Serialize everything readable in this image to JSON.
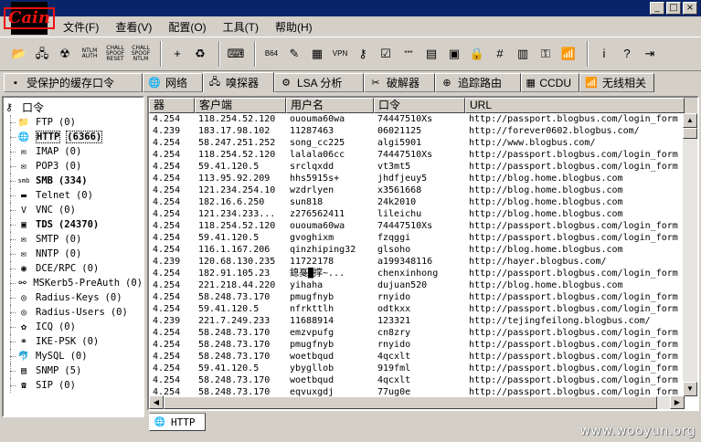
{
  "app": {
    "logo_text": "Cain"
  },
  "window_buttons": [
    "_",
    "□",
    "×"
  ],
  "menu": [
    "文件(F)",
    "查看(V)",
    "配置(O)",
    "工具(T)",
    "帮助(H)"
  ],
  "toolbar": {
    "buttons": [
      {
        "icon": "folder-open-icon",
        "glyph": "📂"
      },
      {
        "icon": "network-card-icon",
        "glyph": "🖧"
      },
      {
        "icon": "radiation-icon",
        "glyph": "☢"
      }
    ],
    "text_buttons": [
      {
        "line1": "NTLM",
        "line2": "AUTH",
        "line3": ""
      },
      {
        "line1": "CHALL",
        "line2": "SPOOF",
        "line3": "RESET"
      },
      {
        "line1": "CHALL",
        "line2": "SPOOF",
        "line3": "NTLM"
      }
    ],
    "buttons2": [
      {
        "icon": "add-icon",
        "glyph": "+"
      },
      {
        "icon": "recycle-bin-icon",
        "glyph": "♻"
      },
      {
        "icon": "decode-icon",
        "glyph": "⌨"
      },
      {
        "icon": "base64-icon",
        "glyph": "B64"
      },
      {
        "icon": "notepad-icon",
        "glyph": "✎"
      },
      {
        "icon": "routing-icon",
        "glyph": "▦"
      },
      {
        "icon": "vpn-icon",
        "glyph": "VPN"
      },
      {
        "icon": "key-icon",
        "glyph": "⚷"
      },
      {
        "icon": "certificate-icon",
        "glyph": "☑"
      },
      {
        "icon": "password-icon",
        "glyph": "***"
      },
      {
        "icon": "terminal-icon",
        "glyph": "▤"
      },
      {
        "icon": "monitor-icon",
        "glyph": "▣"
      },
      {
        "icon": "lock-icon",
        "glyph": "🔒"
      },
      {
        "icon": "hash-icon",
        "glyph": "#"
      },
      {
        "icon": "books-icon",
        "glyph": "▥"
      },
      {
        "icon": "keyring-icon",
        "glyph": "⚿"
      },
      {
        "icon": "wireless-icon",
        "glyph": "📶"
      },
      {
        "icon": "info-icon",
        "glyph": "i"
      },
      {
        "icon": "help-icon",
        "glyph": "?"
      },
      {
        "icon": "exit-icon",
        "glyph": "⇥"
      }
    ]
  },
  "tabs": [
    {
      "label": "受保护的缓存口令",
      "icon": "protected-storage-icon",
      "glyph": "▪",
      "active": false
    },
    {
      "label": "网络",
      "icon": "network-globe-icon",
      "glyph": "🌐",
      "active": false
    },
    {
      "label": "嗅探器",
      "icon": "sniffer-icon",
      "glyph": "🖧",
      "active": true
    },
    {
      "label": "LSA 分析",
      "icon": "lsa-icon",
      "glyph": "⚙",
      "active": false
    },
    {
      "label": "破解器",
      "icon": "cracker-icon",
      "glyph": "✂",
      "active": false
    },
    {
      "label": "追踪路由",
      "icon": "traceroute-icon",
      "glyph": "⊕",
      "active": false
    },
    {
      "label": "CCDU",
      "icon": "ccdu-icon",
      "glyph": "▦",
      "active": false
    },
    {
      "label": "无线相关",
      "icon": "wireless-tab-icon",
      "glyph": "📶",
      "active": false
    }
  ],
  "tree": {
    "root": "口令",
    "items": [
      {
        "label": "FTP",
        "count": "(0)",
        "icon": "ftp-icon",
        "glyph": "📁",
        "bold": false
      },
      {
        "label": "HTTP",
        "count": "(6366)",
        "icon": "http-icon",
        "glyph": "🌐",
        "bold": true,
        "selected": true
      },
      {
        "label": "IMAP",
        "count": "(0)",
        "icon": "imap-icon",
        "glyph": "✉",
        "bold": false
      },
      {
        "label": "POP3",
        "count": "(0)",
        "icon": "pop3-icon",
        "glyph": "✉",
        "bold": false
      },
      {
        "label": "SMB",
        "count": "(334)",
        "icon": "smb-icon",
        "glyph": "smb",
        "bold": true
      },
      {
        "label": "Telnet",
        "count": "(0)",
        "icon": "telnet-icon",
        "glyph": "▬",
        "bold": false
      },
      {
        "label": "VNC",
        "count": "(0)",
        "icon": "vnc-icon",
        "glyph": "V",
        "bold": false
      },
      {
        "label": "TDS",
        "count": "(24370)",
        "icon": "tds-icon",
        "glyph": "▣",
        "bold": true
      },
      {
        "label": "SMTP",
        "count": "(0)",
        "icon": "smtp-icon",
        "glyph": "✉",
        "bold": false
      },
      {
        "label": "NNTP",
        "count": "(0)",
        "icon": "nntp-icon",
        "glyph": "✉",
        "bold": false
      },
      {
        "label": "DCE/RPC",
        "count": "(0)",
        "icon": "dcerpc-icon",
        "glyph": "◉",
        "bold": false
      },
      {
        "label": "MSKerb5-PreAuth",
        "count": "(0)",
        "icon": "kerberos-icon",
        "glyph": "⚯",
        "bold": false
      },
      {
        "label": "Radius-Keys",
        "count": "(0)",
        "icon": "radius-keys-icon",
        "glyph": "◎",
        "bold": false
      },
      {
        "label": "Radius-Users",
        "count": "(0)",
        "icon": "radius-users-icon",
        "glyph": "◎",
        "bold": false
      },
      {
        "label": "ICQ",
        "count": "(0)",
        "icon": "icq-icon",
        "glyph": "✿",
        "bold": false
      },
      {
        "label": "IKE-PSK",
        "count": "(0)",
        "icon": "ike-psk-icon",
        "glyph": "⚭",
        "bold": false
      },
      {
        "label": "MySQL",
        "count": "(0)",
        "icon": "mysql-icon",
        "glyph": "🐬",
        "bold": false
      },
      {
        "label": "SNMP",
        "count": "(5)",
        "icon": "snmp-icon",
        "glyph": "▤",
        "bold": false
      },
      {
        "label": "SIP",
        "count": "(0)",
        "icon": "sip-icon",
        "glyph": "☎",
        "bold": false
      }
    ]
  },
  "table": {
    "columns": [
      "器",
      "客户端",
      "用户名",
      "口令",
      "URL"
    ],
    "rows": [
      [
        "4.254",
        "118.254.52.120",
        "ououma60wa",
        "74447510Xs",
        "http://passport.blogbus.com/login_form"
      ],
      [
        "4.239",
        "183.17.98.102",
        "11287463",
        "06021125",
        "http://forever0602.blogbus.com/"
      ],
      [
        "4.254",
        "58.247.251.252",
        "song_cc225",
        "algi5901",
        "http://www.blogbus.com/"
      ],
      [
        "4.254",
        "118.254.52.120",
        "lalala06cc",
        "74447510Xs",
        "http://passport.blogbus.com/login_form"
      ],
      [
        "4.254",
        "59.41.120.5",
        "srclqxdd",
        "vt3mt5",
        "http://passport.blogbus.com/login_form"
      ],
      [
        "4.254",
        "113.95.92.209",
        "hhs5915s+",
        "jhdfjeuy5",
        "http://blog.home.blogbus.com"
      ],
      [
        "4.254",
        "121.234.254.10",
        "wzdrlyen",
        "x3561668",
        "http://blog.home.blogbus.com"
      ],
      [
        "4.254",
        "182.16.6.250",
        "sun818",
        "24k2010",
        "http://blog.home.blogbus.com"
      ],
      [
        "4.254",
        "121.234.233...",
        "z276562411",
        "lileichu",
        "http://blog.home.blogbus.com"
      ],
      [
        "4.254",
        "118.254.52.120",
        "ououma60wa",
        "74447510Xs",
        "http://passport.blogbus.com/login_form"
      ],
      [
        "4.254",
        "59.41.120.5",
        "gvoghixm",
        "fzqggi",
        "http://passport.blogbus.com/login_form"
      ],
      [
        "4.254",
        "116.1.167.206",
        "qinzhiping32",
        "glsoho",
        "http://blog.home.blogbus.com"
      ],
      [
        "4.239",
        "120.68.130.235",
        "11722178",
        "a199348116",
        "http://hayer.blogbus.com/"
      ],
      [
        "4.254",
        "182.91.105.23",
        "鎴戞█撑~...",
        "chenxinhong",
        "http://passport.blogbus.com/login_form"
      ],
      [
        "4.254",
        "221.218.44.220",
        "yihaha",
        "dujuan520",
        "http://blog.home.blogbus.com"
      ],
      [
        "4.254",
        "58.248.73.170",
        "pmugfnyb",
        "rnyido",
        "http://passport.blogbus.com/login_form"
      ],
      [
        "4.254",
        "59.41.120.5",
        "nfrkttlh",
        "odtkxx",
        "http://passport.blogbus.com/login_form"
      ],
      [
        "4.239",
        "221.7.249.233",
        "11688914",
        "123321",
        "http://tejingfeilong.blogbus.com/"
      ],
      [
        "4.254",
        "58.248.73.170",
        "emzvpufg",
        "cn8zry",
        "http://passport.blogbus.com/login_form"
      ],
      [
        "4.254",
        "58.248.73.170",
        "pmugfnyb",
        "rnyido",
        "http://passport.blogbus.com/login_form"
      ],
      [
        "4.254",
        "58.248.73.170",
        "woetbqud",
        "4qcxlt",
        "http://passport.blogbus.com/login_form"
      ],
      [
        "4.254",
        "59.41.120.5",
        "ybygllob",
        "919fml",
        "http://passport.blogbus.com/login_form"
      ],
      [
        "4.254",
        "58.248.73.170",
        "woetbqud",
        "4qcxlt",
        "http://passport.blogbus.com/login_form"
      ],
      [
        "4.254",
        "58.248.73.170",
        "eqvuxgdj",
        "77ug0e",
        "http://passport.blogbus.com/login_form"
      ]
    ]
  },
  "bottom_tab": {
    "label": "HTTP",
    "icon": "http-icon"
  },
  "watermark": "www.wooyun.org"
}
